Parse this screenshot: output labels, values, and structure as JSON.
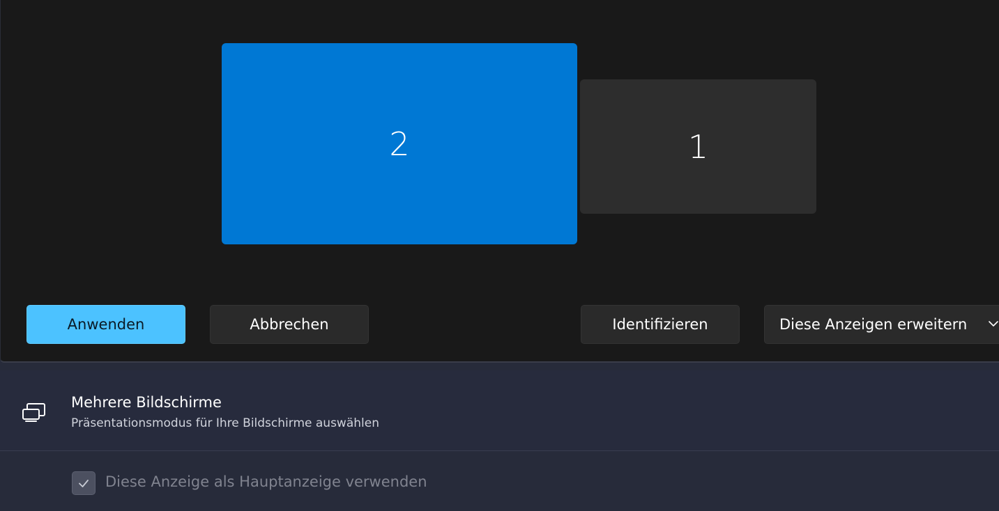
{
  "monitors": [
    {
      "number": "2",
      "selected": true
    },
    {
      "number": "1",
      "selected": false
    }
  ],
  "buttons": {
    "apply_label": "Anwenden",
    "cancel_label": "Abbrechen",
    "identify_label": "Identifizieren"
  },
  "display_mode": {
    "selected": "Diese Anzeigen erweitern",
    "icon": "chevron-down-icon"
  },
  "multiple_displays": {
    "icon": "multiple-displays-icon",
    "title": "Mehrere Bildschirme",
    "subtitle": "Präsentationsmodus für Ihre Bildschirme auswählen"
  },
  "main_display_option": {
    "label": "Diese Anzeige als Hauptanzeige verwenden",
    "checked": true,
    "disabled": true
  },
  "colors": {
    "accent": "#0078d4",
    "primary_button": "#4cc2ff",
    "panel_background": "#191919",
    "settings_background": "#272b3a"
  }
}
